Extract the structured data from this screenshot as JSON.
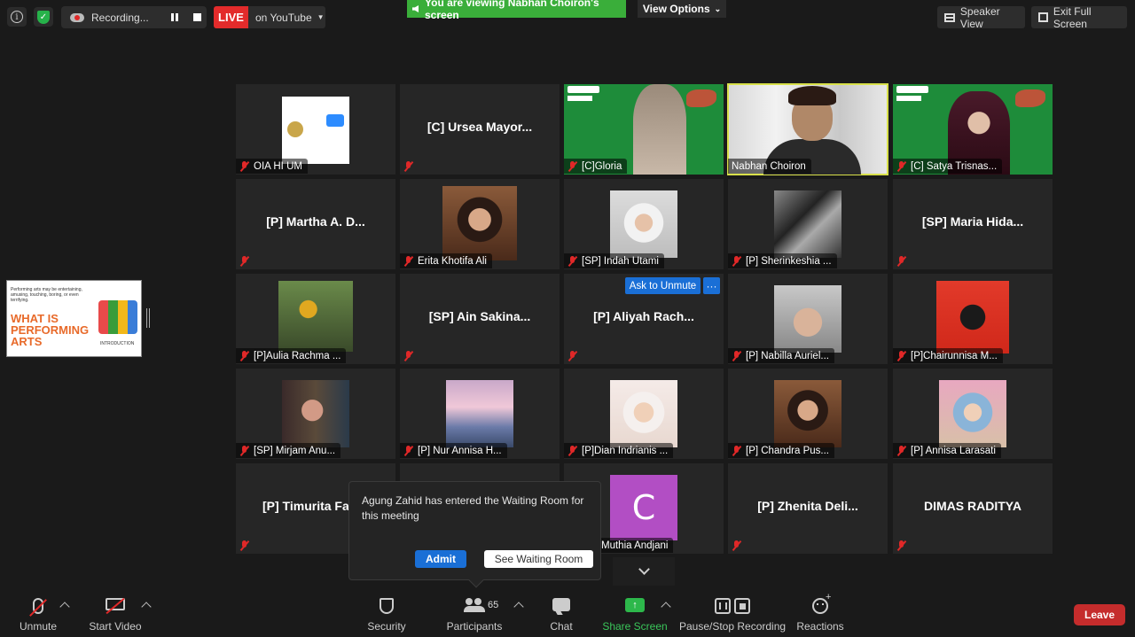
{
  "topbar": {
    "recording_label": "Recording...",
    "live_label": "LIVE",
    "live_destination": "on YouTube",
    "viewing_banner": "You are viewing Nabhan Choiron's screen",
    "view_options": "View Options",
    "speaker_view": "Speaker View",
    "exit_full_screen": "Exit Full Screen"
  },
  "share_thumbnail": {
    "small_text": "Performing arts may be entertaining, amusing, touching, boring, or even terrifying.",
    "heading": "WHAT IS PERFORMING ARTS",
    "tag": "INTRODUCTION"
  },
  "tiles": [
    {
      "name": "OIA HI UM",
      "center": ""
    },
    {
      "name": "",
      "center": "[C]  Ursea Mayor..."
    },
    {
      "name": "[C]Gloria",
      "center": ""
    },
    {
      "name": "Nabhan Choiron",
      "center": ""
    },
    {
      "name": "[C] Satya Trisnas...",
      "center": ""
    },
    {
      "name": "",
      "center": "[P]  Martha  A.  D..."
    },
    {
      "name": "Erita Khotifa Ali",
      "center": ""
    },
    {
      "name": "[SP] Indah Utami",
      "center": ""
    },
    {
      "name": "[P] Sherinkeshia ...",
      "center": ""
    },
    {
      "name": "",
      "center": "[SP]  Maria  Hida..."
    },
    {
      "name": "[P]Aulia Rachma ...",
      "center": ""
    },
    {
      "name": "",
      "center": "[SP]  Ain  Sakina..."
    },
    {
      "name": "",
      "center": "[P]  Aliyah  Rach..."
    },
    {
      "name": "[P] Nabilla Auriel...",
      "center": ""
    },
    {
      "name": "[P]Chairunnisa M...",
      "center": ""
    },
    {
      "name": "[SP] Mirjam Anu...",
      "center": ""
    },
    {
      "name": "[P] Nur Annisa H...",
      "center": ""
    },
    {
      "name": "[P]Dian Indrianis ...",
      "center": ""
    },
    {
      "name": "[P] Chandra Pus...",
      "center": ""
    },
    {
      "name": "[P] Annisa Larasati",
      "center": ""
    },
    {
      "name": "",
      "center": "[P]  Timurita  Fa"
    },
    {
      "name": "Muthia Andjani",
      "center": "",
      "avatar_letter": "C"
    },
    {
      "name": "",
      "center": "[P]  Zhenita  Deli..."
    },
    {
      "name": "",
      "center": "DIMAS RADITYA"
    }
  ],
  "ask_to_unmute": "Ask to Unmute",
  "more_label": "···",
  "waiting_popup": {
    "message": "Agung Zahid has entered the Waiting Room for this meeting",
    "admit": "Admit",
    "see_waiting_room": "See Waiting Room"
  },
  "toolbar": {
    "unmute": "Unmute",
    "start_video": "Start Video",
    "security": "Security",
    "participants": "Participants",
    "participant_count": "65",
    "chat": "Chat",
    "share_screen": "Share Screen",
    "pause_stop_recording": "Pause/Stop Recording",
    "reactions": "Reactions",
    "leave": "Leave"
  },
  "colors": {
    "live_red": "#e32b2b",
    "banner_green": "#3aae3a",
    "accent_blue": "#1a6fd6",
    "share_green": "#2db84b",
    "leave_red": "#c52c2c",
    "active_speaker_yellow": "#d8e04a"
  }
}
